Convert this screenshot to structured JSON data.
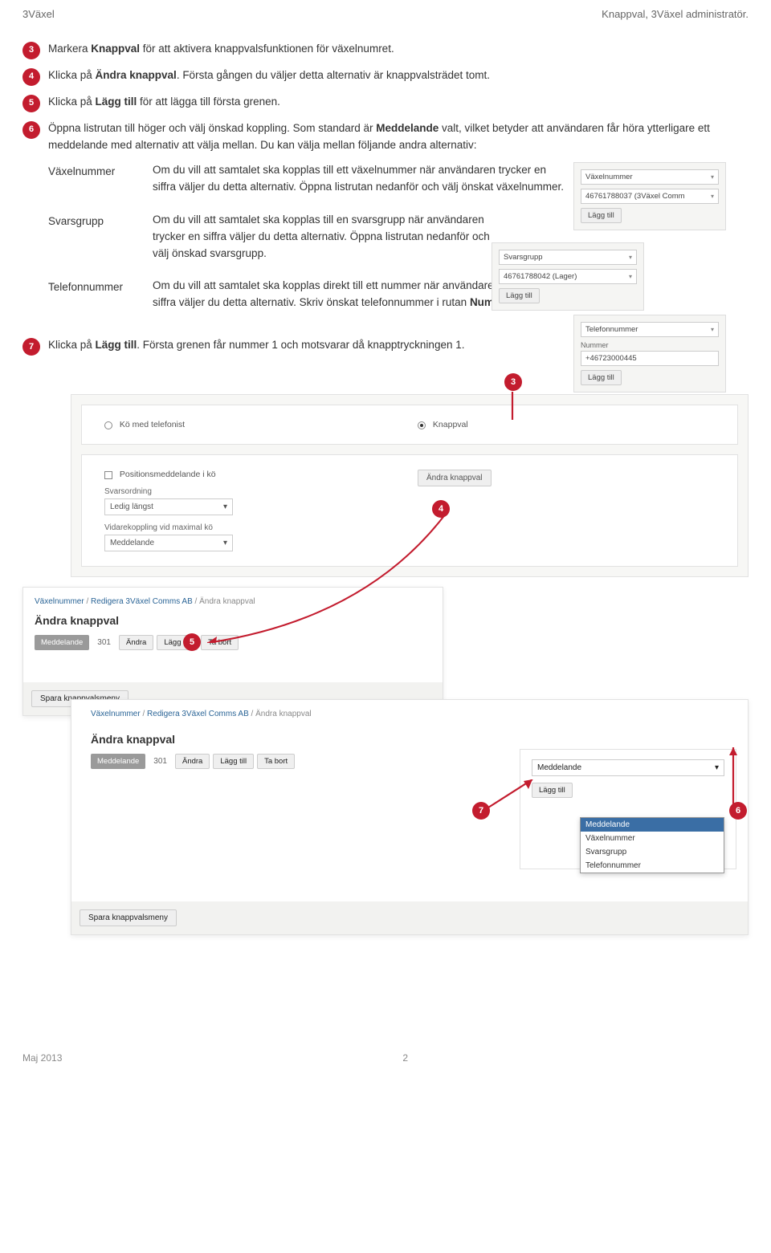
{
  "header": {
    "left": "3Växel",
    "right": "Knappval, 3Växel administratör."
  },
  "steps": {
    "s3": "Markera <b>Knappval</b> för att aktivera knappvalsfunktionen för växelnumret.",
    "s4": "Klicka på <b>Ändra knappval</b>. Första gången du väljer detta alternativ är knappvalsträdet tomt.",
    "s5": "Klicka på <b>Lägg till</b> för att lägga till första grenen.",
    "s6": "Öppna listrutan till höger och välj önskad koppling. Som standard är <b>Meddelande</b> valt, vilket betyder att användaren får höra ytterligare ett meddelande med alternativ att välja mellan. Du kan välja mellan följande andra alternativ:",
    "s7": "Klicka på <b>Lägg till</b>. Första grenen får nummer 1 och motsvarar då knapptryckningen 1."
  },
  "defs": {
    "vx_label": "Växelnummer",
    "vx_desc": "Om du vill att samtalet ska kopplas till ett växelnummer när användaren trycker en siffra väljer du detta alternativ. Öppna listrutan nedanför och välj önskat växelnummer.",
    "sv_label": "Svarsgrupp",
    "sv_desc": "Om du vill att samtalet ska kopplas till en svarsgrupp när användaren trycker en siffra väljer du detta alternativ. Öppna listrutan nedanför och välj önskad svarsgrupp.",
    "tn_label": "Telefonnummer",
    "tn_desc": "Om du vill att samtalet ska kopplas direkt till ett nummer när användaren trycker en siffra väljer du detta alternativ. Skriv önskat telefonnummer i rutan <b>Nummer</b> nedanför."
  },
  "mini": {
    "vx_sel1": "Växelnummer",
    "vx_sel2": "46761788037 (3Växel Comm",
    "sv_sel1": "Svarsgrupp",
    "sv_sel2": "46761788042 (Lager)",
    "tn_sel1": "Telefonnummer",
    "tn_lbl": "Nummer",
    "tn_input": "+46723000445",
    "btn": "Lägg till"
  },
  "shot": {
    "radio_left": "Kö med telefonist",
    "radio_right": "Knappval",
    "chk_label": "Positionsmeddelande i kö",
    "btn_andra": "Ändra knappval",
    "lbl_svarsordning": "Svarsordning",
    "sel_svars": "Ledig längst",
    "lbl_vidare": "Vidarekoppling vid maximal kö",
    "sel_vidare": "Meddelande",
    "crumb_vaxel": "Växelnummer",
    "crumb_sep": " / ",
    "crumb_red": "Redigera 3Växel Comms AB",
    "crumb_ak": "Ändra knappval",
    "panel_title": "Ändra knappval",
    "pill_txt": "Meddelande",
    "pill_num": "301",
    "btn_andra_s": "Ändra",
    "btn_lagg": "Lägg till",
    "btn_tabort": "Ta bort",
    "btn_save": "Spara knappvalsmeny",
    "sel_med": "Meddelande",
    "dd_opt1": "Meddelande",
    "dd_opt2": "Växelnummer",
    "dd_opt3": "Svarsgrupp",
    "dd_opt4": "Telefonnummer"
  },
  "markers": {
    "m3": "3",
    "m4": "4",
    "m5": "5",
    "m6": "6",
    "m7": "7"
  },
  "footer": {
    "left": "Maj 2013",
    "page": "2"
  }
}
